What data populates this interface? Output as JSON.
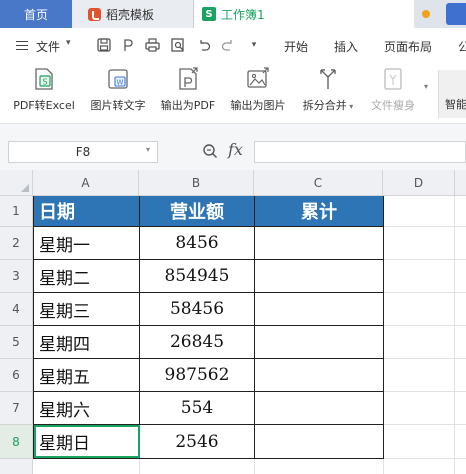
{
  "tabs": [
    {
      "label": "首页"
    },
    {
      "label": "稻壳模板"
    },
    {
      "label": "工作簿1"
    }
  ],
  "menu": {
    "file": "文件",
    "items": [
      "开始",
      "插入",
      "页面布局",
      "公"
    ]
  },
  "ribbon": {
    "buttons": [
      "PDF转Excel",
      "图片转文字",
      "输出为PDF",
      "输出为图片",
      "拆分合并",
      "文件瘦身"
    ],
    "more_label": "智能"
  },
  "formula_bar": {
    "cell_ref": "F8",
    "fx": "fx",
    "formula": ""
  },
  "grid": {
    "columns": [
      "A",
      "B",
      "C",
      "D"
    ],
    "rows": [
      "1",
      "2",
      "3",
      "4",
      "5",
      "6",
      "7",
      "8"
    ],
    "selected_cell": "A8",
    "header": [
      "日期",
      "营业额",
      "累计"
    ],
    "data": [
      {
        "day": "星期一",
        "revenue": "8456",
        "cumulative": ""
      },
      {
        "day": "星期二",
        "revenue": "854945",
        "cumulative": ""
      },
      {
        "day": "星期三",
        "revenue": "58456",
        "cumulative": ""
      },
      {
        "day": "星期四",
        "revenue": "26845",
        "cumulative": ""
      },
      {
        "day": "星期五",
        "revenue": "987562",
        "cumulative": ""
      },
      {
        "day": "星期六",
        "revenue": "554",
        "cumulative": ""
      },
      {
        "day": "星期日",
        "revenue": "2546",
        "cumulative": ""
      }
    ]
  },
  "colors": {
    "header_fill": "#2e75b6",
    "accent_green": "#1aa260",
    "home_tab": "#4a78c8"
  }
}
